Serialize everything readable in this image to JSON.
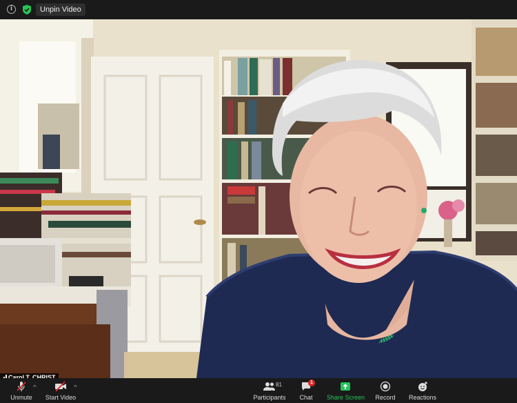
{
  "topbar": {
    "info_icon": "info-icon",
    "shield_icon": "shield-check-icon",
    "unpin_label": "Unpin Video"
  },
  "video": {
    "participant_name": "Carol T. CHRIST"
  },
  "toolbar": {
    "unmute_label": "Unmute",
    "start_video_label": "Start Video",
    "participants_label": "Participants",
    "participants_count": "81",
    "chat_label": "Chat",
    "chat_badge": "1",
    "share_screen_label": "Share Screen",
    "record_label": "Record",
    "reactions_label": "Reactions"
  },
  "colors": {
    "bar_bg": "#1a1a1a",
    "share_green": "#25c45a",
    "badge_red": "#e02828",
    "muted_red": "#e02828"
  }
}
